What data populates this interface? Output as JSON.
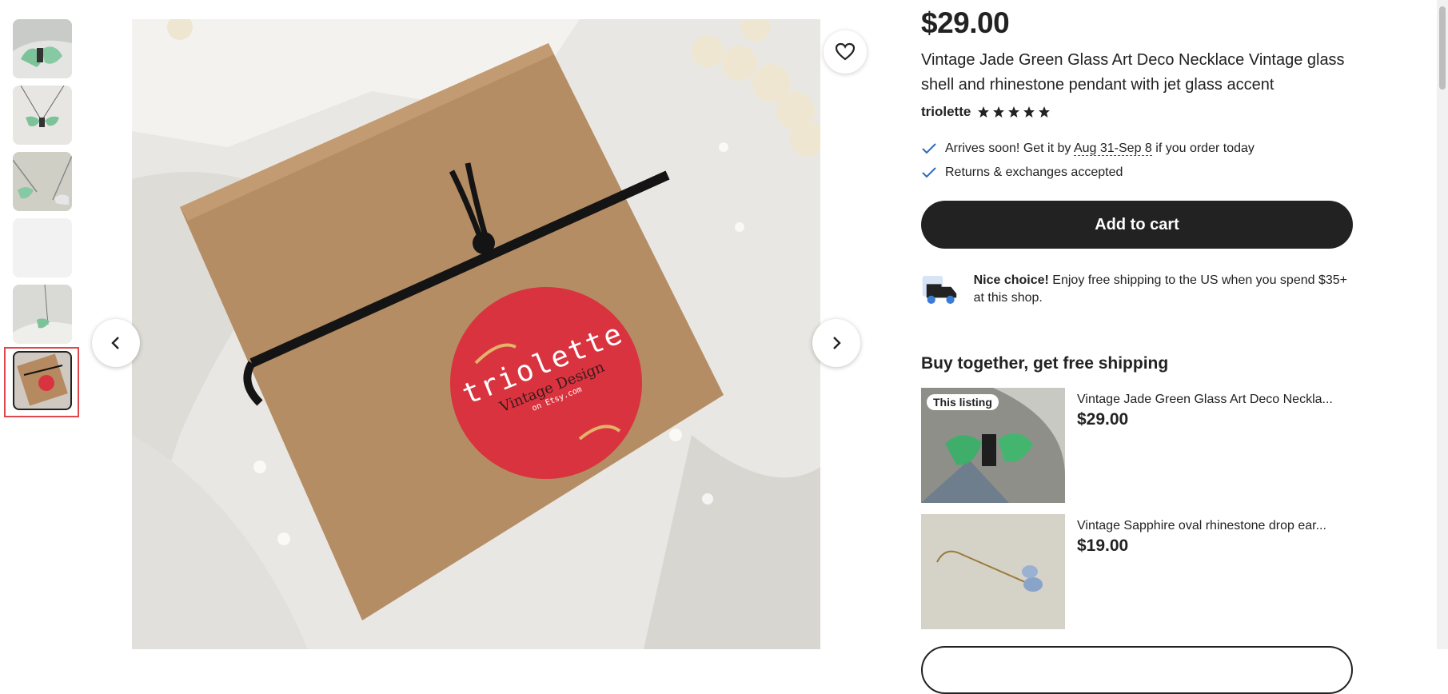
{
  "gallery": {
    "thumbnails": [
      {
        "name": "thumbnail-1"
      },
      {
        "name": "thumbnail-2"
      },
      {
        "name": "thumbnail-3"
      },
      {
        "name": "thumbnail-4"
      },
      {
        "name": "thumbnail-5"
      },
      {
        "name": "thumbnail-6",
        "selected": true
      }
    ],
    "main_image_sticker": {
      "line1": "triolette",
      "line2": "Vintage Design",
      "line3": "on Etsy.com"
    },
    "icons": {
      "prev": "chevron-left-icon",
      "next": "chevron-right-icon",
      "favorite": "heart-icon"
    }
  },
  "product": {
    "price": "$29.00",
    "title": "Vintage Jade Green Glass Art Deco Necklace Vintage glass shell and rhinestone pendant with jet glass accent",
    "shop_name": "triolette",
    "rating_stars": 5,
    "delivery_prefix": "Arrives soon! Get it by ",
    "delivery_dates": "Aug 31-Sep 8",
    "delivery_suffix": " if you order today",
    "returns": "Returns & exchanges accepted",
    "add_to_cart": "Add to cart",
    "shipping_bold": "Nice choice!",
    "shipping_text": " Enjoy free shipping to the US when you spend $35+ at this shop."
  },
  "bundle": {
    "title": "Buy together, get free shipping",
    "items": [
      {
        "badge": "This listing",
        "name": "Vintage Jade Green Glass Art Deco Neckla...",
        "price": "$29.00"
      },
      {
        "name": "Vintage Sapphire oval rhinestone drop ear...",
        "price": "$19.00"
      }
    ]
  },
  "colors": {
    "accent": "#222222",
    "selection": "#e0474c",
    "check": "#2a6ebb",
    "sticker": "#d9333f"
  }
}
